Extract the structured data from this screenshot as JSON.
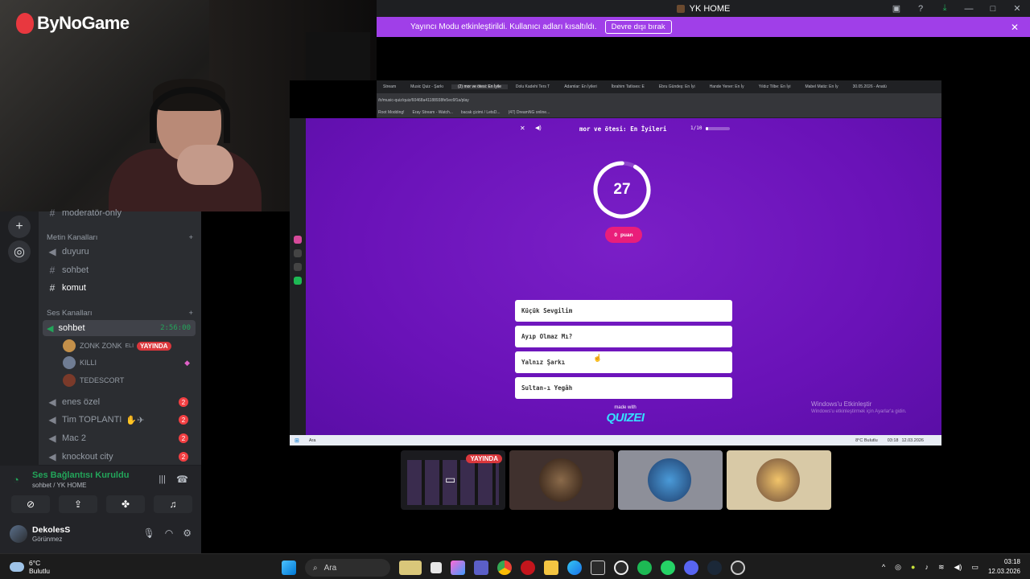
{
  "window": {
    "title": "YK HOME"
  },
  "banner": {
    "text": "Yayıncı Modu etkinleştirildi. Kullanıcı adları kısaltıldı.",
    "button": "Devre dışı bırak"
  },
  "webcam": {
    "logo": "ByNoGame"
  },
  "sidebar": {
    "partial_channel": "moderatör-only",
    "text_category": "Metin Kanalları",
    "text_channels": [
      "duyuru",
      "sohbet",
      "komut"
    ],
    "voice_category": "Ses Kanalları",
    "active_voice": {
      "name": "sohbet",
      "timer": "2:56:00"
    },
    "voice_users": [
      {
        "name": "ZONK ZONK",
        "suffix": "ELI",
        "live": "YAYINDA"
      },
      {
        "name": "KILLI"
      },
      {
        "name": "TEDESCORT"
      }
    ],
    "voice_channels": [
      {
        "name": "enes özel",
        "badge": "2"
      },
      {
        "name": "Tim TOPLANTI",
        "badge": "2"
      },
      {
        "name": "Mac 2",
        "badge": "2"
      },
      {
        "name": "knockout city",
        "badge": "2"
      }
    ]
  },
  "voice_panel": {
    "status": "Ses Bağlantısı Kuruldu",
    "location": "sohbet / YK HOME"
  },
  "user_panel": {
    "name": "DekolesS",
    "status": "Görünmez"
  },
  "browser": {
    "tabs": [
      "Stream",
      "Music Quiz - Şarkı",
      "(2) mor ve ötesi: En İyile",
      "Dolu Kadehi Ters T",
      "Adamlar: En İyileri",
      "İbrahim Tatlıses: E",
      "Ebru Gündeş: En İyi",
      "Hande Yener: En İy",
      "Yıldız Tilbe: En İyi",
      "Mabel Matiz: En İy",
      "30.05.2026 - Anatü"
    ],
    "url": "/tr/music-quiz/quiz/60468a41188938fe5ec6f1a/play",
    "bookmarks": [
      "Root Modding!",
      "Eray Stream - Watch...",
      "bacak çizimi / LetsD...",
      "(47) DreamNG online..."
    ]
  },
  "quiz": {
    "title": "mor ve ötesi: En İyileri",
    "progress": "1/10",
    "progress_fraction": 0.1,
    "timer": "27",
    "score": "0",
    "score_label": "puan",
    "answers": [
      "Küçük Sevgilim",
      "Ayıp Olmaz Mı?",
      "Yalnız Şarkı",
      "Sultan-ı Yegâh"
    ],
    "made_with": "made with",
    "brand": "QUIZEI"
  },
  "windows_activation": {
    "title": "Windows'u Etkinleştir",
    "sub": "Windows'u etkinleştirmek için Ayarlar'a gidin."
  },
  "inner_taskbar": {
    "search": "Ara",
    "weather": "8°C Bulutlu",
    "time": "03:18",
    "date": "12.03.2026"
  },
  "tiles": {
    "live_label": "YAYINDA"
  },
  "taskbar": {
    "weather_temp": "6°C",
    "weather_desc": "Bulutlu",
    "search": "Ara",
    "time": "03:18",
    "date": "12.03.2026"
  }
}
